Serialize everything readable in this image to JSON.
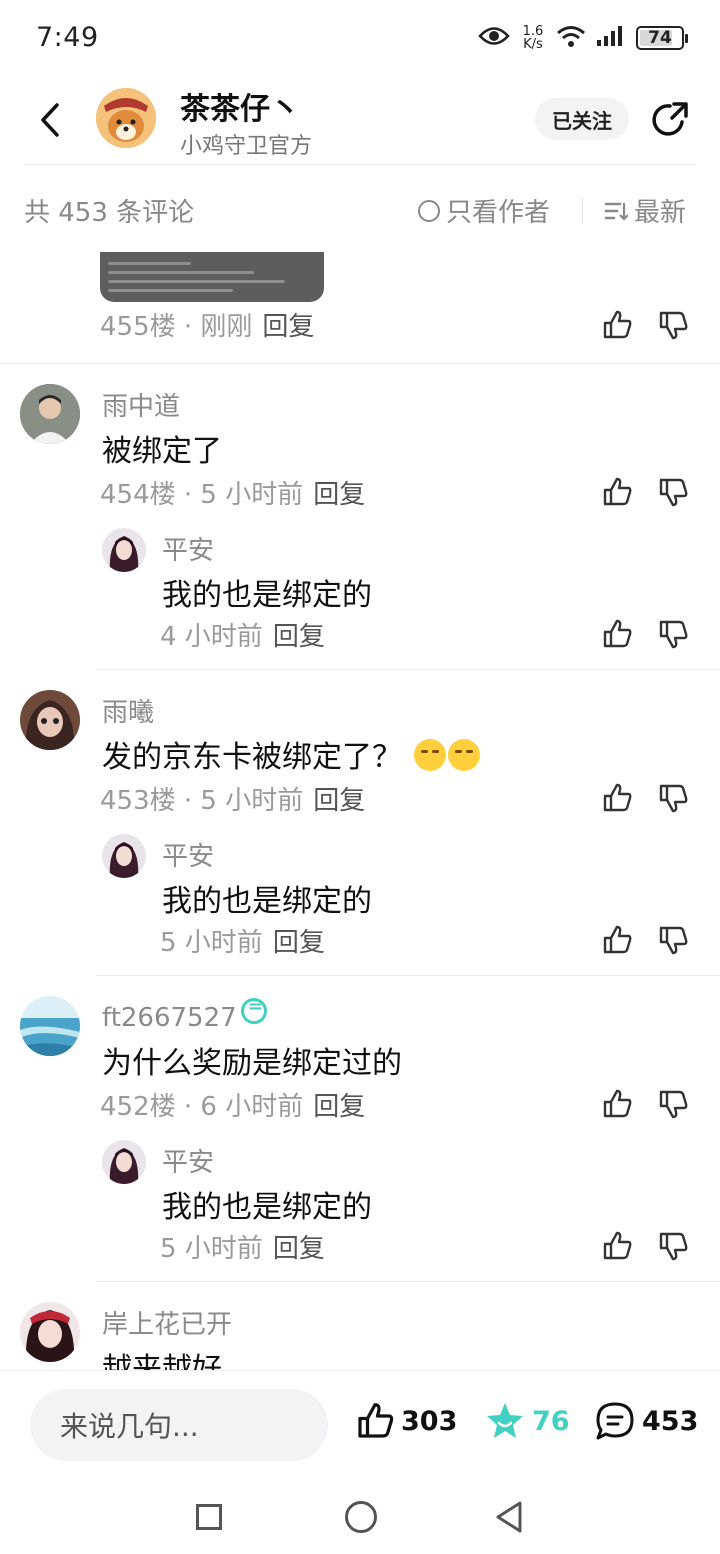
{
  "status_bar": {
    "time": "7:49",
    "net_speed_value": "1.6",
    "net_speed_unit": "K/s",
    "battery": "74"
  },
  "header": {
    "title": "茶茶仔丶",
    "subtitle": "小鸡守卫官方",
    "follow_label": "已关注"
  },
  "sort_bar": {
    "count_label": "共 453 条评论",
    "only_author_label": "只看作者",
    "sort_label": "最新"
  },
  "comments": [
    {
      "floor_meta": "455楼 · 刚刚",
      "reply": "回复",
      "has_image": true
    },
    {
      "user": "雨中道",
      "text": "被绑定了",
      "floor_meta": "454楼 · 5 小时前",
      "reply": "回复",
      "sub": {
        "user": "平安",
        "text": "我的也是绑定的",
        "meta": "4 小时前",
        "reply": "回复"
      }
    },
    {
      "user": "雨曦",
      "text": "发的京东卡被绑定了？",
      "emojis": [
        "thinking-face-emoji",
        "thinking-face-emoji"
      ],
      "floor_meta": "453楼 · 5 小时前",
      "reply": "回复",
      "sub": {
        "user": "平安",
        "text": "我的也是绑定的",
        "meta": "5 小时前",
        "reply": "回复"
      }
    },
    {
      "user": "ft2667527",
      "text": "为什么奖励是绑定过的",
      "floor_meta": "452楼 · 6 小时前",
      "reply": "回复",
      "sub": {
        "user": "平安",
        "text": "我的也是绑定的",
        "meta": "5 小时前",
        "reply": "回复"
      }
    },
    {
      "user": "岸上花已开",
      "text": "越来越好"
    }
  ],
  "bottom_bar": {
    "input_placeholder": "来说几句...",
    "likes": "303",
    "stars": "76",
    "comments": "453"
  },
  "colors": {
    "accent": "#41d1c1",
    "muted_text": "#8a8a8a",
    "meta_text": "#9a9a9a"
  }
}
